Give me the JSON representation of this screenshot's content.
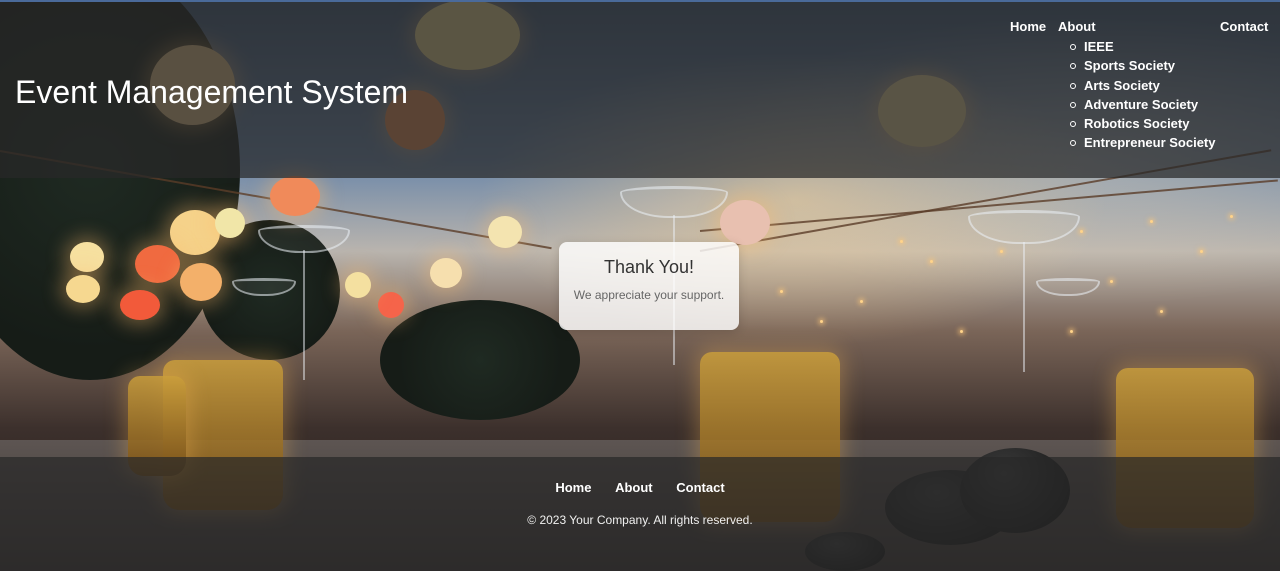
{
  "header": {
    "site_title": "Event Management System",
    "nav": {
      "home": "Home",
      "about": "About",
      "contact": "Contact"
    },
    "about_submenu": [
      "IEEE",
      "Sports Society",
      "Arts Society",
      "Adventure Society",
      "Robotics Society",
      "Entrepreneur Society"
    ]
  },
  "card": {
    "title": "Thank You!",
    "message": "We appreciate your support."
  },
  "footer": {
    "nav": {
      "home": "Home",
      "about": "About",
      "contact": "Contact"
    },
    "copyright": "© 2023 Your Company. All rights reserved."
  },
  "colors": {
    "overlay": "#282828",
    "text": "#ffffff",
    "card_bg": "#ffffff"
  }
}
